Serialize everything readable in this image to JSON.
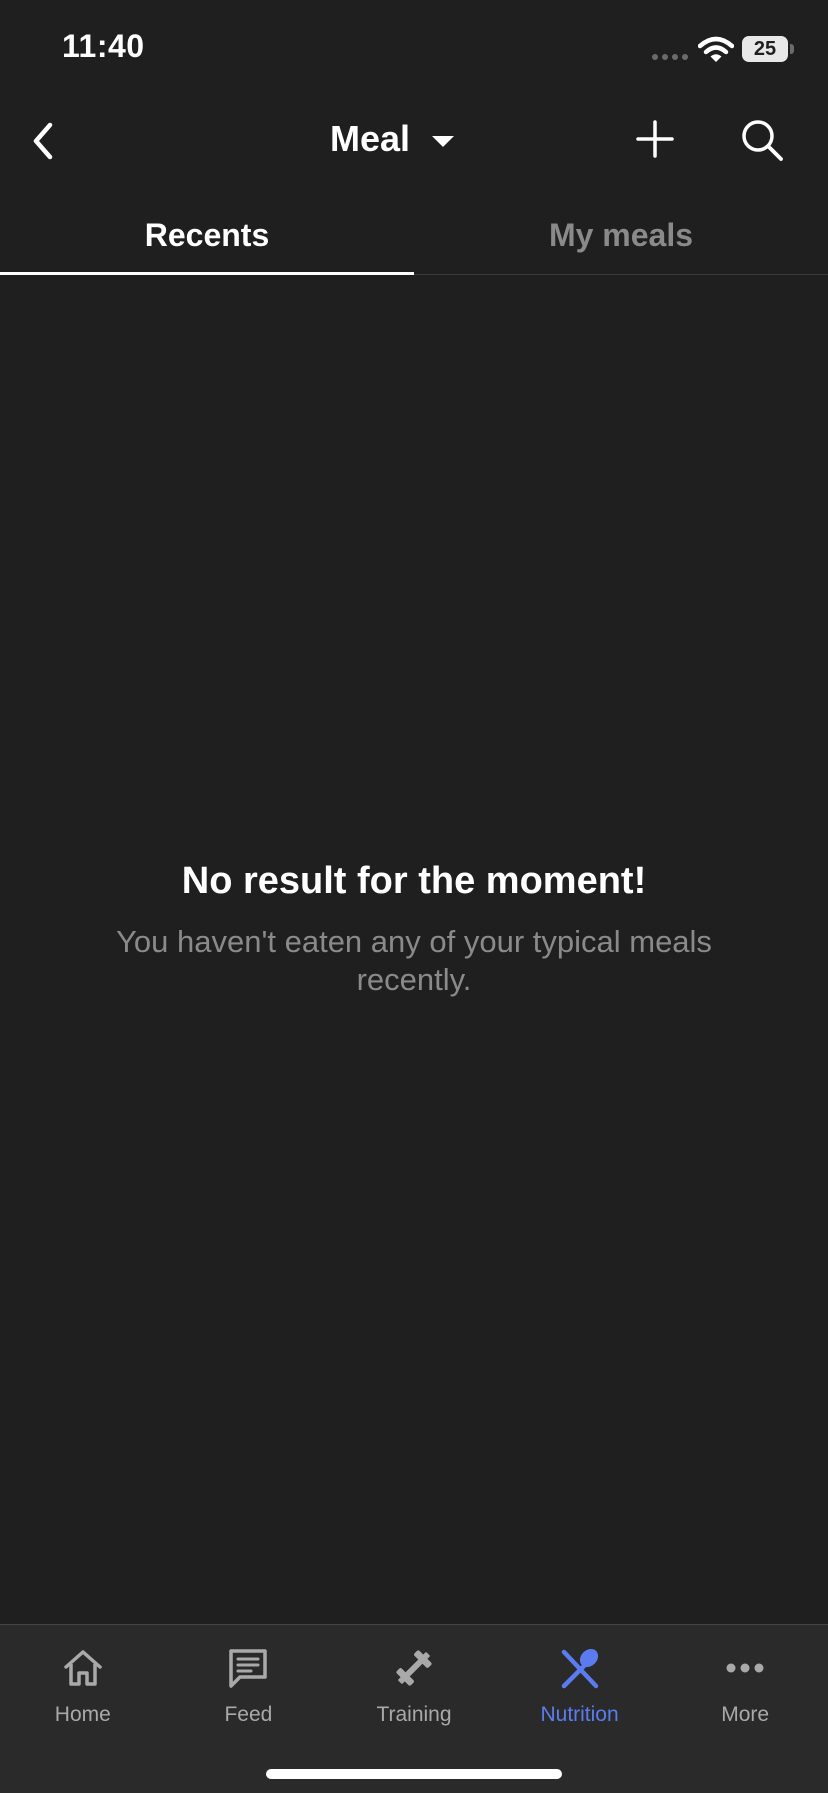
{
  "status_bar": {
    "time": "11:40",
    "battery_level": "25",
    "icons": [
      "signal-dots-icon",
      "wifi-icon",
      "battery-icon"
    ]
  },
  "header": {
    "title": "Meal",
    "icons": {
      "back": "chevron-left-icon",
      "dropdown": "caret-down-icon",
      "add": "plus-icon",
      "search": "search-icon"
    }
  },
  "tabs": [
    {
      "label": "Recents",
      "active": true
    },
    {
      "label": "My meals",
      "active": false
    }
  ],
  "empty_state": {
    "title": "No result for the moment!",
    "subtitle": "You haven't eaten any of your typical meals recently."
  },
  "bottom_nav": {
    "items": [
      {
        "label": "Home",
        "icon": "home-icon",
        "active": false
      },
      {
        "label": "Feed",
        "icon": "message-icon",
        "active": false
      },
      {
        "label": "Training",
        "icon": "dumbbell-icon",
        "active": false
      },
      {
        "label": "Nutrition",
        "icon": "utensils-icon",
        "active": true
      },
      {
        "label": "More",
        "icon": "more-dots-icon",
        "active": false
      }
    ]
  },
  "colors": {
    "background": "#1f1f1f",
    "nav_background": "#2a2a2a",
    "accent": "#5b7cf0",
    "text_primary": "#ffffff",
    "text_secondary": "#8a8a8a"
  }
}
